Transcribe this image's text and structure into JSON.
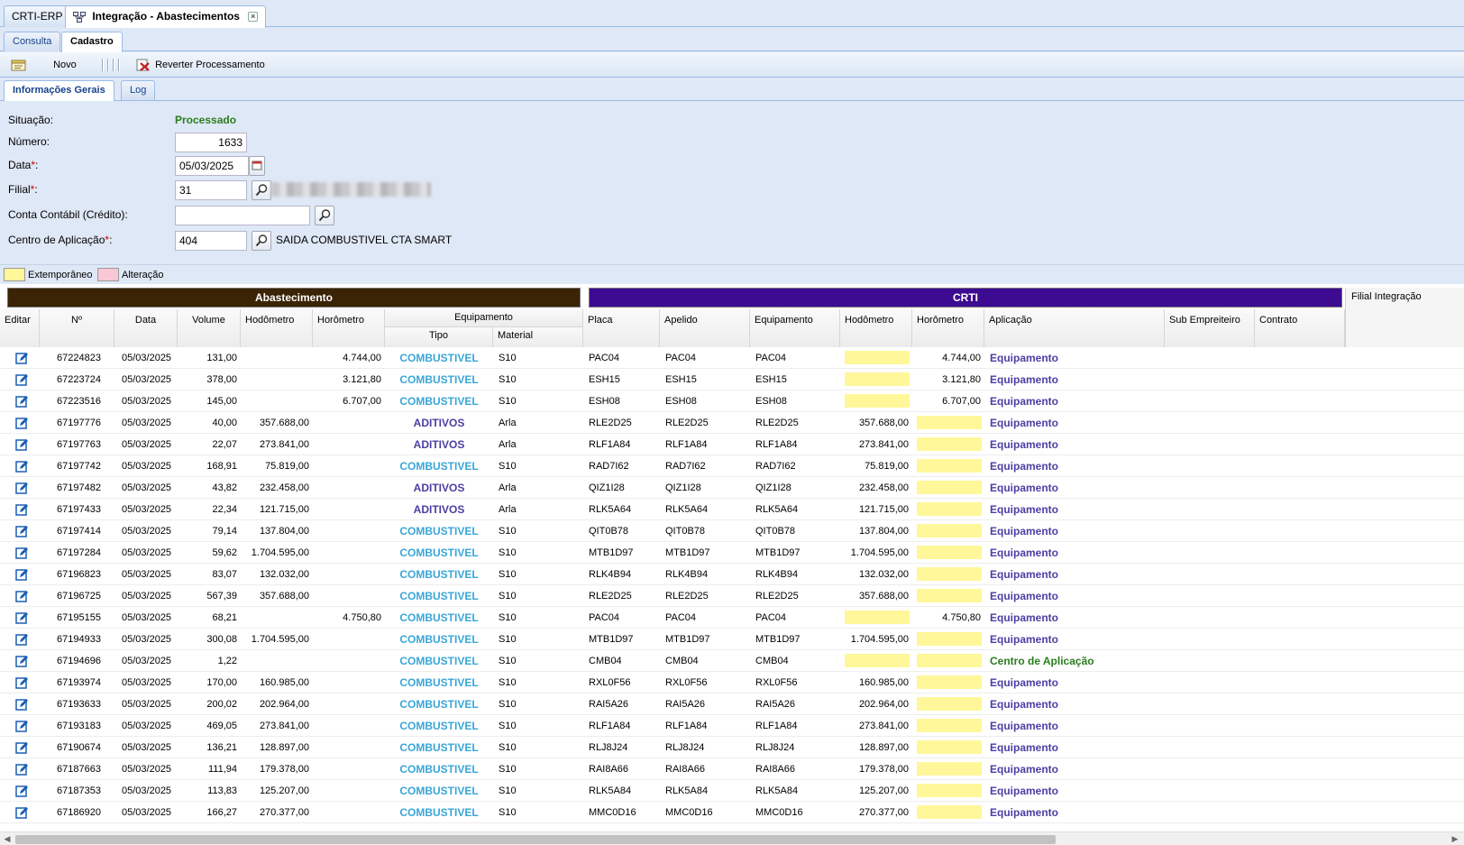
{
  "window_tabs": [
    {
      "label": "CRTI-ERP"
    },
    {
      "label": "Integração - Abastecimentos"
    }
  ],
  "mode_tabs": [
    {
      "label": "Consulta"
    },
    {
      "label": "Cadastro"
    }
  ],
  "toolbar": {
    "new_label": "Novo",
    "revert_label": "Reverter Processamento"
  },
  "inner_tabs": [
    {
      "label": "Informações Gerais"
    },
    {
      "label": "Log"
    }
  ],
  "form": {
    "situacao_label": "Situação:",
    "situacao_value": "Processado",
    "numero_label": "Número:",
    "numero_value": "1633",
    "data_label": "Data",
    "data_value": "05/03/2025",
    "filial_label": "Filial",
    "filial_value": "31",
    "conta_label": "Conta Contábil (Crédito):",
    "conta_value": "",
    "centro_label": "Centro de Aplicação",
    "centro_value": "404",
    "centro_desc": "SAIDA COMBUSTIVEL CTA SMART",
    "required_mark": "*",
    "colon": ":"
  },
  "legend": {
    "extemporaneo": "Extemporâneo",
    "alteracao": "Alteração",
    "colors": {
      "extemporaneo": "#fff799",
      "alteracao": "#f8c8d4"
    }
  },
  "groups": {
    "abastecimento": "Abastecimento",
    "crti": "CRTI",
    "filial_integracao": "Filial Integração"
  },
  "colors": {
    "abastecimento": "#3b2305",
    "crti": "#3d0b91",
    "status_green": "#2a7d1e"
  },
  "columns": {
    "editar": "Editar",
    "numero": "Nº",
    "data": "Data",
    "volume": "Volume",
    "hodometro": "Hodômetro",
    "horometro": "Horômetro",
    "equipamento": "Equipamento",
    "tipo": "Tipo",
    "material": "Material",
    "placa": "Placa",
    "apelido": "Apelido",
    "crti_equipamento": "Equipamento",
    "crti_hodometro": "Hodômetro",
    "crti_horometro": "Horômetro",
    "aplicacao": "Aplicação",
    "sub_empreiteiro": "Sub Empreiteiro",
    "contrato": "Contrato"
  },
  "rows": [
    {
      "num": "67224823",
      "data": "05/03/2025",
      "vol": "131,00",
      "hod": "",
      "hor": "4.744,00",
      "tipo": "COMBUSTIVEL",
      "mat": "S10",
      "placa": "PAC04",
      "apelido": "PAC04",
      "equip": "PAC04",
      "chod": "",
      "chor": "4.744,00",
      "apl": "Equipamento"
    },
    {
      "num": "67223724",
      "data": "05/03/2025",
      "vol": "378,00",
      "hod": "",
      "hor": "3.121,80",
      "tipo": "COMBUSTIVEL",
      "mat": "S10",
      "placa": "ESH15",
      "apelido": "ESH15",
      "equip": "ESH15",
      "chod": "",
      "chor": "3.121,80",
      "apl": "Equipamento"
    },
    {
      "num": "67223516",
      "data": "05/03/2025",
      "vol": "145,00",
      "hod": "",
      "hor": "6.707,00",
      "tipo": "COMBUSTIVEL",
      "mat": "S10",
      "placa": "ESH08",
      "apelido": "ESH08",
      "equip": "ESH08",
      "chod": "",
      "chor": "6.707,00",
      "apl": "Equipamento"
    },
    {
      "num": "67197776",
      "data": "05/03/2025",
      "vol": "40,00",
      "hod": "357.688,00",
      "hor": "",
      "tipo": "ADITIVOS",
      "mat": "Arla",
      "placa": "RLE2D25",
      "apelido": "RLE2D25",
      "equip": "RLE2D25",
      "chod": "357.688,00",
      "chor": "",
      "apl": "Equipamento"
    },
    {
      "num": "67197763",
      "data": "05/03/2025",
      "vol": "22,07",
      "hod": "273.841,00",
      "hor": "",
      "tipo": "ADITIVOS",
      "mat": "Arla",
      "placa": "RLF1A84",
      "apelido": "RLF1A84",
      "equip": "RLF1A84",
      "chod": "273.841,00",
      "chor": "",
      "apl": "Equipamento"
    },
    {
      "num": "67197742",
      "data": "05/03/2025",
      "vol": "168,91",
      "hod": "75.819,00",
      "hor": "",
      "tipo": "COMBUSTIVEL",
      "mat": "S10",
      "placa": "RAD7I62",
      "apelido": "RAD7I62",
      "equip": "RAD7I62",
      "chod": "75.819,00",
      "chor": "",
      "apl": "Equipamento"
    },
    {
      "num": "67197482",
      "data": "05/03/2025",
      "vol": "43,82",
      "hod": "232.458,00",
      "hor": "",
      "tipo": "ADITIVOS",
      "mat": "Arla",
      "placa": "QIZ1I28",
      "apelido": "QIZ1I28",
      "equip": "QIZ1I28",
      "chod": "232.458,00",
      "chor": "",
      "apl": "Equipamento"
    },
    {
      "num": "67197433",
      "data": "05/03/2025",
      "vol": "22,34",
      "hod": "121.715,00",
      "hor": "",
      "tipo": "ADITIVOS",
      "mat": "Arla",
      "placa": "RLK5A64",
      "apelido": "RLK5A64",
      "equip": "RLK5A64",
      "chod": "121.715,00",
      "chor": "",
      "apl": "Equipamento"
    },
    {
      "num": "67197414",
      "data": "05/03/2025",
      "vol": "79,14",
      "hod": "137.804,00",
      "hor": "",
      "tipo": "COMBUSTIVEL",
      "mat": "S10",
      "placa": "QIT0B78",
      "apelido": "QIT0B78",
      "equip": "QIT0B78",
      "chod": "137.804,00",
      "chor": "",
      "apl": "Equipamento"
    },
    {
      "num": "67197284",
      "data": "05/03/2025",
      "vol": "59,62",
      "hod": "1.704.595,00",
      "hor": "",
      "tipo": "COMBUSTIVEL",
      "mat": "S10",
      "placa": "MTB1D97",
      "apelido": "MTB1D97",
      "equip": "MTB1D97",
      "chod": "1.704.595,00",
      "chor": "",
      "apl": "Equipamento"
    },
    {
      "num": "67196823",
      "data": "05/03/2025",
      "vol": "83,07",
      "hod": "132.032,00",
      "hor": "",
      "tipo": "COMBUSTIVEL",
      "mat": "S10",
      "placa": "RLK4B94",
      "apelido": "RLK4B94",
      "equip": "RLK4B94",
      "chod": "132.032,00",
      "chor": "",
      "apl": "Equipamento"
    },
    {
      "num": "67196725",
      "data": "05/03/2025",
      "vol": "567,39",
      "hod": "357.688,00",
      "hor": "",
      "tipo": "COMBUSTIVEL",
      "mat": "S10",
      "placa": "RLE2D25",
      "apelido": "RLE2D25",
      "equip": "RLE2D25",
      "chod": "357.688,00",
      "chor": "",
      "apl": "Equipamento"
    },
    {
      "num": "67195155",
      "data": "05/03/2025",
      "vol": "68,21",
      "hod": "",
      "hor": "4.750,80",
      "tipo": "COMBUSTIVEL",
      "mat": "S10",
      "placa": "PAC04",
      "apelido": "PAC04",
      "equip": "PAC04",
      "chod": "",
      "chor": "4.750,80",
      "apl": "Equipamento"
    },
    {
      "num": "67194933",
      "data": "05/03/2025",
      "vol": "300,08",
      "hod": "1.704.595,00",
      "hor": "",
      "tipo": "COMBUSTIVEL",
      "mat": "S10",
      "placa": "MTB1D97",
      "apelido": "MTB1D97",
      "equip": "MTB1D97",
      "chod": "1.704.595,00",
      "chor": "",
      "apl": "Equipamento"
    },
    {
      "num": "67194696",
      "data": "05/03/2025",
      "vol": "1,22",
      "hod": "",
      "hor": "",
      "tipo": "COMBUSTIVEL",
      "mat": "S10",
      "placa": "CMB04",
      "apelido": "CMB04",
      "equip": "CMB04",
      "chod": "",
      "chor": "",
      "apl": "Centro de Aplicação"
    },
    {
      "num": "67193974",
      "data": "05/03/2025",
      "vol": "170,00",
      "hod": "160.985,00",
      "hor": "",
      "tipo": "COMBUSTIVEL",
      "mat": "S10",
      "placa": "RXL0F56",
      "apelido": "RXL0F56",
      "equip": "RXL0F56",
      "chod": "160.985,00",
      "chor": "",
      "apl": "Equipamento"
    },
    {
      "num": "67193633",
      "data": "05/03/2025",
      "vol": "200,02",
      "hod": "202.964,00",
      "hor": "",
      "tipo": "COMBUSTIVEL",
      "mat": "S10",
      "placa": "RAI5A26",
      "apelido": "RAI5A26",
      "equip": "RAI5A26",
      "chod": "202.964,00",
      "chor": "",
      "apl": "Equipamento"
    },
    {
      "num": "67193183",
      "data": "05/03/2025",
      "vol": "469,05",
      "hod": "273.841,00",
      "hor": "",
      "tipo": "COMBUSTIVEL",
      "mat": "S10",
      "placa": "RLF1A84",
      "apelido": "RLF1A84",
      "equip": "RLF1A84",
      "chod": "273.841,00",
      "chor": "",
      "apl": "Equipamento"
    },
    {
      "num": "67190674",
      "data": "05/03/2025",
      "vol": "136,21",
      "hod": "128.897,00",
      "hor": "",
      "tipo": "COMBUSTIVEL",
      "mat": "S10",
      "placa": "RLJ8J24",
      "apelido": "RLJ8J24",
      "equip": "RLJ8J24",
      "chod": "128.897,00",
      "chor": "",
      "apl": "Equipamento"
    },
    {
      "num": "67187663",
      "data": "05/03/2025",
      "vol": "111,94",
      "hod": "179.378,00",
      "hor": "",
      "tipo": "COMBUSTIVEL",
      "mat": "S10",
      "placa": "RAI8A66",
      "apelido": "RAI8A66",
      "equip": "RAI8A66",
      "chod": "179.378,00",
      "chor": "",
      "apl": "Equipamento"
    },
    {
      "num": "67187353",
      "data": "05/03/2025",
      "vol": "113,83",
      "hod": "125.207,00",
      "hor": "",
      "tipo": "COMBUSTIVEL",
      "mat": "S10",
      "placa": "RLK5A84",
      "apelido": "RLK5A84",
      "equip": "RLK5A84",
      "chod": "125.207,00",
      "chor": "",
      "apl": "Equipamento"
    },
    {
      "num": "67186920",
      "data": "05/03/2025",
      "vol": "166,27",
      "hod": "270.377,00",
      "hor": "",
      "tipo": "COMBUSTIVEL",
      "mat": "S10",
      "placa": "MMC0D16",
      "apelido": "MMC0D16",
      "equip": "MMC0D16",
      "chod": "270.377,00",
      "chor": "",
      "apl": "Equipamento"
    }
  ]
}
